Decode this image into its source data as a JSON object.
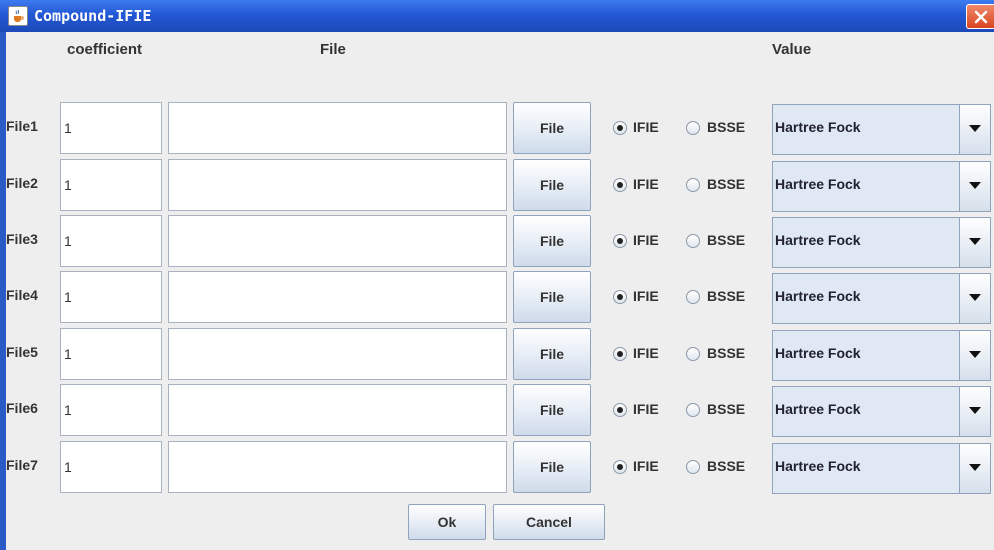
{
  "window": {
    "title": "Compound-IFIE",
    "icon": "java-cup-icon",
    "close_icon": "close-icon",
    "colors": {
      "titlebar": "#2358d4",
      "close": "#d9441f",
      "panel": "#eeeeee"
    }
  },
  "headers": {
    "coefficient": "coefficient",
    "file": "File",
    "value": "Value"
  },
  "rows": [
    {
      "label": "File1",
      "coefficient": "1",
      "path": "",
      "button": "File",
      "radio1": "IFIE",
      "radio2": "BSSE",
      "selected": "IFIE",
      "value": "Hartree Fock"
    },
    {
      "label": "File2",
      "coefficient": "1",
      "path": "",
      "button": "File",
      "radio1": "IFIE",
      "radio2": "BSSE",
      "selected": "IFIE",
      "value": "Hartree Fock"
    },
    {
      "label": "File3",
      "coefficient": "1",
      "path": "",
      "button": "File",
      "radio1": "IFIE",
      "radio2": "BSSE",
      "selected": "IFIE",
      "value": "Hartree Fock"
    },
    {
      "label": "File4",
      "coefficient": "1",
      "path": "",
      "button": "File",
      "radio1": "IFIE",
      "radio2": "BSSE",
      "selected": "IFIE",
      "value": "Hartree Fock"
    },
    {
      "label": "File5",
      "coefficient": "1",
      "path": "",
      "button": "File",
      "radio1": "IFIE",
      "radio2": "BSSE",
      "selected": "IFIE",
      "value": "Hartree Fock"
    },
    {
      "label": "File6",
      "coefficient": "1",
      "path": "",
      "button": "File",
      "radio1": "IFIE",
      "radio2": "BSSE",
      "selected": "IFIE",
      "value": "Hartree Fock"
    },
    {
      "label": "File7",
      "coefficient": "1",
      "path": "",
      "button": "File",
      "radio1": "IFIE",
      "radio2": "BSSE",
      "selected": "IFIE",
      "value": "Hartree Fock"
    }
  ],
  "buttons": {
    "ok": "Ok",
    "cancel": "Cancel"
  }
}
